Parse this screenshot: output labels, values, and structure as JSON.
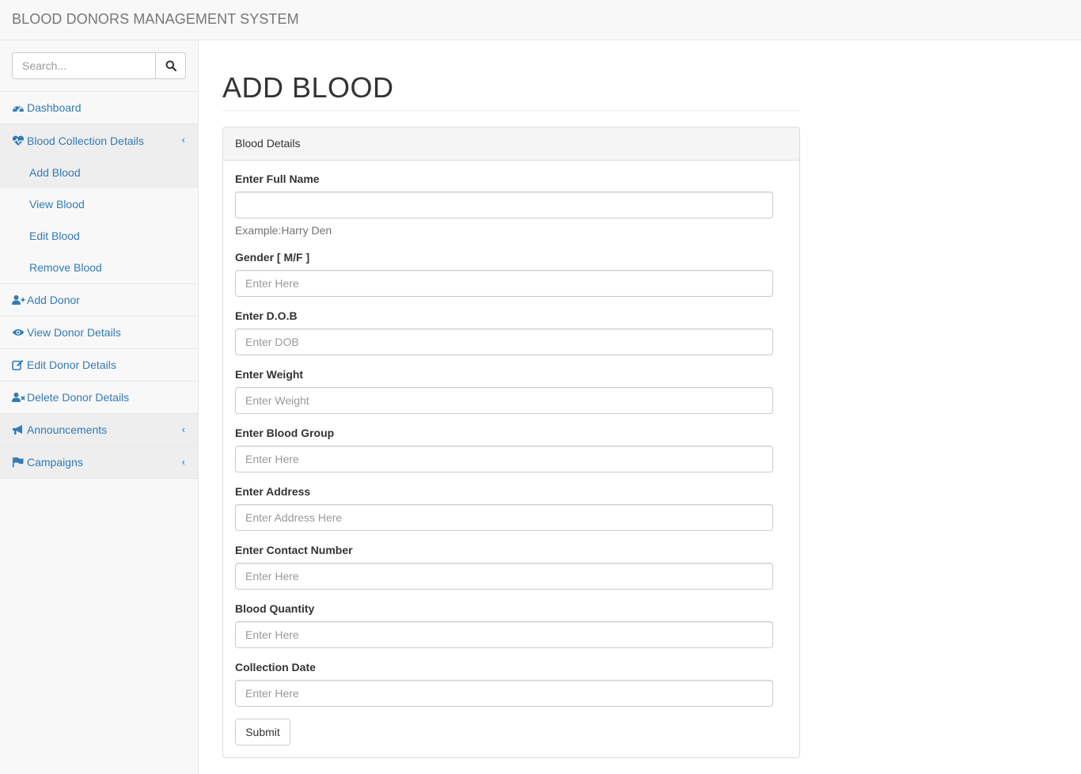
{
  "app": {
    "brand": "BLOOD DONORS MANAGEMENT SYSTEM"
  },
  "colors": {
    "link": "#337ab7",
    "sidebar_bg": "#f8f8f8",
    "active_bg": "#eeeeee",
    "border": "#e7e7e7"
  },
  "sidebar": {
    "search_placeholder": "Search...",
    "search_icon": "search-icon",
    "items": [
      {
        "label": "Dashboard",
        "icon": "dashboard-icon"
      },
      {
        "label": "Blood Collection Details",
        "icon": "heartbeat-icon",
        "expanded": true,
        "children": [
          "Add Blood",
          "View Blood",
          "Edit Blood",
          "Remove Blood"
        ]
      },
      {
        "label": "Add Donor",
        "icon": "user-plus-icon"
      },
      {
        "label": "View Donor Details",
        "icon": "eye-icon"
      },
      {
        "label": "Edit Donor Details",
        "icon": "edit-icon"
      },
      {
        "label": "Delete Donor Details",
        "icon": "user-times-icon"
      },
      {
        "label": "Announcements",
        "icon": "bullhorn-icon",
        "expandable": true
      },
      {
        "label": "Campaigns",
        "icon": "flag-icon",
        "expandable": true
      }
    ],
    "chevron": "‹"
  },
  "page": {
    "title": "ADD BLOOD",
    "panel_heading": "Blood Details",
    "fields": [
      {
        "label": "Enter Full Name",
        "value": "",
        "placeholder": "",
        "help": "Example:Harry Den"
      },
      {
        "label": "Gender [ M/F ]",
        "value": "",
        "placeholder": "Enter Here"
      },
      {
        "label": "Enter D.O.B",
        "value": "",
        "placeholder": "Enter DOB"
      },
      {
        "label": "Enter Weight",
        "value": "",
        "placeholder": "Enter Weight"
      },
      {
        "label": "Enter Blood Group",
        "value": "",
        "placeholder": "Enter Here"
      },
      {
        "label": "Enter Address",
        "value": "",
        "placeholder": "Enter Address Here"
      },
      {
        "label": "Enter Contact Number",
        "value": "",
        "placeholder": "Enter Here"
      },
      {
        "label": "Blood Quantity",
        "value": "",
        "placeholder": "Enter Here"
      },
      {
        "label": "Collection Date",
        "value": "",
        "placeholder": "Enter Here"
      }
    ],
    "submit_label": "Submit"
  }
}
